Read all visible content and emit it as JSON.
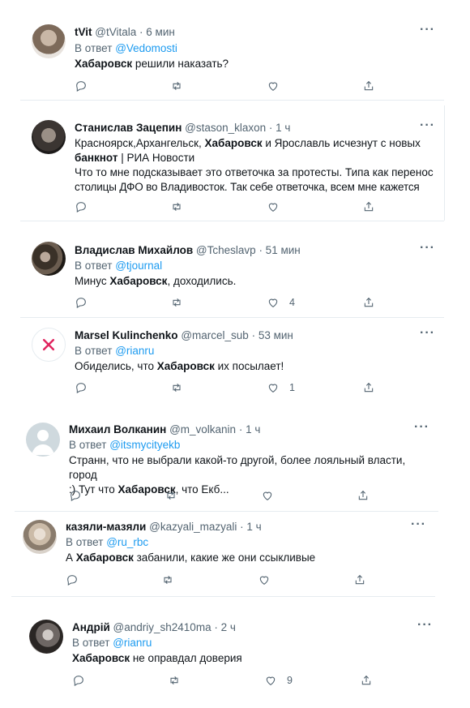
{
  "tweets": [
    {
      "name": "tVit",
      "handle": "@tVitala",
      "time": "· 6 мин",
      "reply_prefix": "В ответ",
      "reply_to": "@Vedomosti",
      "body_parts": [
        "Хабаровск",
        " решили наказать?"
      ],
      "likes": ""
    },
    {
      "name": "Станислав Зацепин",
      "handle": "@stason_klaxon",
      "time": "· 1 ч",
      "body_line1": [
        "Красноярск,Архангельск, ",
        "Хабаровск",
        " и Ярославль исчезнут с новых"
      ],
      "body_line2": [
        "банкнот",
        " | РИА Новости"
      ],
      "body_line3": "Что то мне подсказывает это ответочка за протесты. Типа как перенос",
      "body_line4": "столицы ДФО во Владивосток. Так себе ответочка, всем мне кажется",
      "likes": ""
    },
    {
      "name": "Владислав Михайлов",
      "handle": "@Tcheslavp",
      "time": "· 51 мин",
      "reply_prefix": "В ответ",
      "reply_to": "@tjournal",
      "body_parts": [
        "Минус ",
        "Хабаровск",
        ", доходились."
      ],
      "likes": "4"
    },
    {
      "name": "Marsel Kulinchenko",
      "handle": "@marcel_sub",
      "time": "· 53 мин",
      "reply_prefix": "В ответ",
      "reply_to": "@rianru",
      "body_parts": [
        "Обиделись, что ",
        "Хабаровск",
        " их посылает!"
      ],
      "likes": "1"
    },
    {
      "name": "Михаил Волканин",
      "handle": "@m_volkanin",
      "time": "· 1 ч",
      "reply_prefix": "В ответ",
      "reply_to": "@itsmycityekb",
      "body_line1": "Странн, что не выбрали какой-то другой, более лояльный власти, город",
      "body_line2": [
        ":) Тут что ",
        "Хабаровск",
        ", что Екб..."
      ],
      "likes": ""
    },
    {
      "name": "казяли-мазяли",
      "handle": "@kazyali_mazyali",
      "time": "· 1 ч",
      "reply_prefix": "В ответ",
      "reply_to": "@ru_rbc",
      "body_parts": [
        "А ",
        "Хабаровск",
        " забанили, какие же они ссыкливые"
      ],
      "likes": ""
    },
    {
      "name": "Андрій",
      "handle": "@andriy_sh2410ma",
      "time": "· 2 ч",
      "reply_prefix": "В ответ",
      "reply_to": "@rianru",
      "body_parts": [
        "Хабаровск",
        " не оправдал доверия"
      ],
      "likes": "9"
    }
  ],
  "icons": {
    "more": "more-icon",
    "reply": "reply-icon",
    "retweet": "retweet-icon",
    "like": "like-icon",
    "share": "share-icon"
  },
  "more_glyph": "···",
  "colors": {
    "link": "#1d9bf0",
    "muted": "#536471",
    "text": "#0f1419",
    "x_mark": "#e0245e"
  }
}
